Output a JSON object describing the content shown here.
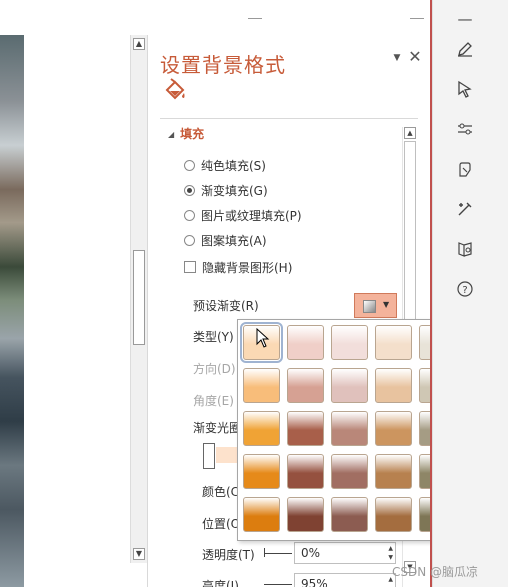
{
  "pane": {
    "title": "设置背景格式",
    "section": "填充",
    "fill_options": [
      {
        "label": "纯色填充(S)",
        "selected": false
      },
      {
        "label": "渐变填充(G)",
        "selected": true
      },
      {
        "label": "图片或纹理填充(P)",
        "selected": false
      },
      {
        "label": "图案填充(A)",
        "selected": false
      }
    ],
    "hide_bg": "隐藏背景图形(H)",
    "preset": "预设渐变(R)",
    "type": "类型(Y)",
    "direction": "方向(D)",
    "angle": "角度(E)",
    "stops": "渐变光圈",
    "color": "颜色(C",
    "position": "位置(O",
    "transparency": {
      "label": "透明度(T)",
      "value": "0%"
    },
    "brightness": {
      "label": "亮度(I)",
      "value": "95%"
    }
  },
  "gallery": {
    "colors": {
      "row1": [
        "#fbd9b4",
        "#f0cfc8",
        "#f2dedb",
        "#f4dfcb",
        "#e8e3d8",
        "#f2d3b2"
      ],
      "row2": [
        "#f8bd7a",
        "#d6a193",
        "#e0c1bc",
        "#e8c39f",
        "#cfc7b4",
        "#e6ad78"
      ],
      "row3": [
        "#f0a335",
        "#a85f4a",
        "#b98779",
        "#cc955f",
        "#a59c84",
        "#d8842c"
      ],
      "row4": [
        "#e68a1a",
        "#95513f",
        "#a16e62",
        "#b7814f",
        "#8e8667",
        "#c66e1c"
      ],
      "row5": [
        "#dc7d0f",
        "#7f4232",
        "#8c5c51",
        "#a46d3f",
        "#7e7656",
        "#b05e16"
      ]
    },
    "selected": "row1.0"
  },
  "watermark": "CSDN @脑瓜凉",
  "colors": {
    "accent": "#c75b39",
    "separator": "#c0504d"
  },
  "icons": [
    "minimize-icon",
    "pen-icon",
    "cursor-icon",
    "sliders-icon",
    "hand-icon",
    "tools-icon",
    "book-icon",
    "help-icon"
  ]
}
